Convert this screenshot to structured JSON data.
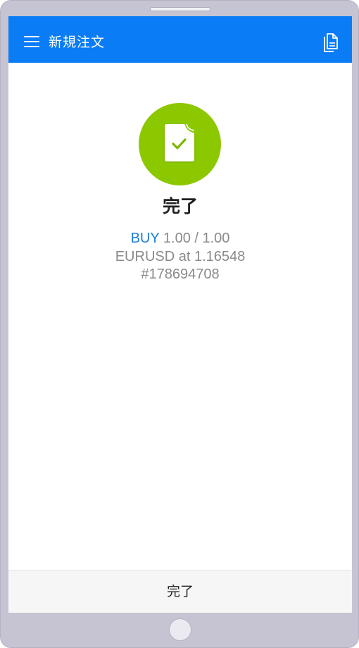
{
  "header": {
    "title": "新規注文",
    "menu_icon": "hamburger-menu-icon",
    "right_icon": "documents-icon"
  },
  "result": {
    "icon": "document-check-icon",
    "title": "完了",
    "side": "BUY",
    "volume": "1.00 / 1.00",
    "symbol_price": "EURUSD at 1.16548",
    "ticket": "#178694708"
  },
  "footer": {
    "done_label": "完了"
  },
  "colors": {
    "appbar": "#0a7cf5",
    "success": "#8cc800",
    "buy": "#1a7fe0",
    "detail_text": "#8a8a8a"
  }
}
